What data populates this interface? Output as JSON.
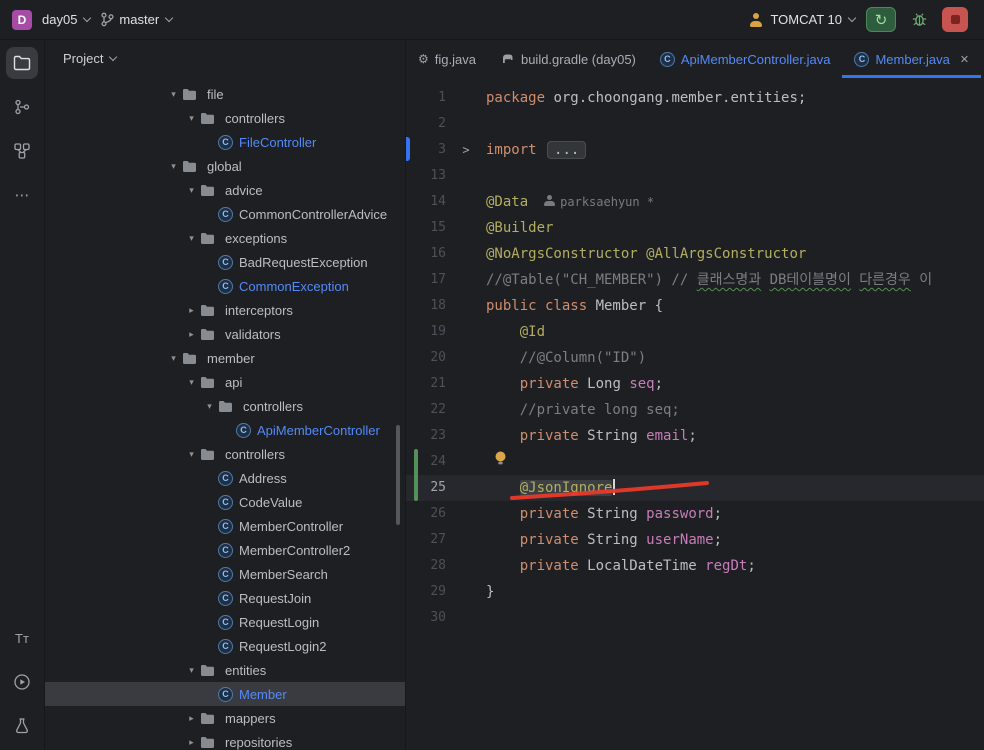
{
  "titlebar": {
    "project_badge": "D",
    "project_name": "day05",
    "branch": "master",
    "run_config": "TOMCAT 10"
  },
  "panel": {
    "header": "Project"
  },
  "icons": {
    "more_glyph": "⋯",
    "text_tool_glyph": "Тт",
    "close_glyph": "✕",
    "chevron_expanded": "▾",
    "chevron_collapsed": "▸",
    "fold_glyph": ">",
    "class_badge": "C",
    "run_glyph": "↻"
  },
  "tabs": [
    {
      "label": "fig.java",
      "icon": "gear",
      "state": "plain"
    },
    {
      "label": "build.gradle (day05)",
      "icon": "gradle",
      "state": "plain"
    },
    {
      "label": "ApiMemberController.java",
      "icon": "class",
      "state": "modified"
    },
    {
      "label": "Member.java",
      "icon": "class",
      "state": "modified",
      "active": true,
      "closable": true
    }
  ],
  "tree": [
    {
      "label": "file",
      "kind": "folder",
      "level": 0,
      "expanded": true
    },
    {
      "label": "controllers",
      "kind": "folder",
      "level": 1,
      "expanded": true
    },
    {
      "label": "FileController",
      "kind": "class",
      "level": 2,
      "modified": true
    },
    {
      "label": "global",
      "kind": "folder",
      "level": 0,
      "expanded": true
    },
    {
      "label": "advice",
      "kind": "folder",
      "level": 1,
      "expanded": true
    },
    {
      "label": "CommonControllerAdvice",
      "kind": "class",
      "level": 2
    },
    {
      "label": "exceptions",
      "kind": "folder",
      "level": 1,
      "expanded": true
    },
    {
      "label": "BadRequestException",
      "kind": "class",
      "level": 2
    },
    {
      "label": "CommonException",
      "kind": "class",
      "level": 2,
      "modified": true
    },
    {
      "label": "interceptors",
      "kind": "folder",
      "level": 1,
      "expanded": false
    },
    {
      "label": "validators",
      "kind": "folder",
      "level": 1,
      "expanded": false
    },
    {
      "label": "member",
      "kind": "folder",
      "level": 0,
      "expanded": true
    },
    {
      "label": "api",
      "kind": "folder",
      "level": 1,
      "expanded": true
    },
    {
      "label": "controllers",
      "kind": "folder",
      "level": 2,
      "expanded": true
    },
    {
      "label": "ApiMemberController",
      "kind": "class",
      "level": 3,
      "modified": true
    },
    {
      "label": "controllers",
      "kind": "folder",
      "level": 1,
      "expanded": true
    },
    {
      "label": "Address",
      "kind": "class",
      "level": 2
    },
    {
      "label": "CodeValue",
      "kind": "class",
      "level": 2
    },
    {
      "label": "MemberController",
      "kind": "class",
      "level": 2
    },
    {
      "label": "MemberController2",
      "kind": "class",
      "level": 2
    },
    {
      "label": "MemberSearch",
      "kind": "class",
      "level": 2
    },
    {
      "label": "RequestJoin",
      "kind": "class",
      "level": 2
    },
    {
      "label": "RequestLogin",
      "kind": "class",
      "level": 2
    },
    {
      "label": "RequestLogin2",
      "kind": "class",
      "level": 2
    },
    {
      "label": "entities",
      "kind": "folder",
      "level": 1,
      "expanded": true
    },
    {
      "label": "Member",
      "kind": "class",
      "level": 2,
      "modified": true,
      "selected": true
    },
    {
      "label": "mappers",
      "kind": "folder",
      "level": 1,
      "expanded": false
    },
    {
      "label": "repositories",
      "kind": "folder",
      "level": 1,
      "expanded": false
    }
  ],
  "editor": {
    "lines": [
      {
        "num": "1",
        "segs": [
          [
            "kw",
            "package "
          ],
          [
            "pl",
            "org.choongang.member.entities;"
          ]
        ]
      },
      {
        "num": "2",
        "segs": []
      },
      {
        "num": "3",
        "fold": true,
        "segs": [
          [
            "kw",
            "import "
          ],
          [
            "fold",
            "..."
          ]
        ]
      },
      {
        "num": "13",
        "segs": []
      },
      {
        "num": "14",
        "segs": [
          [
            "ann",
            "@Data"
          ],
          [
            "inlay",
            "parksaehyun *"
          ]
        ]
      },
      {
        "num": "15",
        "segs": [
          [
            "ann",
            "@Builder"
          ]
        ]
      },
      {
        "num": "16",
        "segs": [
          [
            "ann",
            "@NoArgsConstructor"
          ],
          [
            "pl",
            " "
          ],
          [
            "ann",
            "@AllArgsConstructor"
          ]
        ]
      },
      {
        "num": "17",
        "segs": [
          [
            "cm",
            "//@Table(\"CH_MEMBER\") // "
          ],
          [
            "typo",
            "클래스명과"
          ],
          [
            "cm",
            " "
          ],
          [
            "typo",
            "DB테이블명이"
          ],
          [
            "cm",
            " "
          ],
          [
            "typo",
            "다른경우"
          ],
          [
            "cm",
            " 이"
          ]
        ]
      },
      {
        "num": "18",
        "segs": [
          [
            "kw",
            "public class "
          ],
          [
            "pl",
            "Member {"
          ]
        ]
      },
      {
        "num": "19",
        "segs": [
          [
            "pl",
            "    "
          ],
          [
            "ann",
            "@Id"
          ]
        ]
      },
      {
        "num": "20",
        "segs": [
          [
            "pl",
            "    "
          ],
          [
            "cm",
            "//@Column(\"ID\")"
          ]
        ]
      },
      {
        "num": "21",
        "segs": [
          [
            "pl",
            "    "
          ],
          [
            "kw",
            "private "
          ],
          [
            "pl",
            "Long "
          ],
          [
            "fd",
            "seq"
          ],
          [
            "pl",
            ";"
          ]
        ]
      },
      {
        "num": "22",
        "segs": [
          [
            "pl",
            "    "
          ],
          [
            "cm",
            "//private long seq;"
          ]
        ]
      },
      {
        "num": "23",
        "segs": [
          [
            "pl",
            "    "
          ],
          [
            "kw",
            "private "
          ],
          [
            "pl",
            "String "
          ],
          [
            "fd",
            "email"
          ],
          [
            "pl",
            ";"
          ]
        ]
      },
      {
        "num": "24",
        "bulb": true,
        "segs": []
      },
      {
        "num": "25",
        "current": true,
        "caret": true,
        "segs": [
          [
            "pl",
            "    "
          ],
          [
            "annhl",
            "@JsonIgnore"
          ]
        ]
      },
      {
        "num": "26",
        "segs": [
          [
            "pl",
            "    "
          ],
          [
            "kw",
            "private "
          ],
          [
            "pl",
            "String "
          ],
          [
            "fd",
            "password"
          ],
          [
            "pl",
            ";"
          ]
        ]
      },
      {
        "num": "27",
        "segs": [
          [
            "pl",
            "    "
          ],
          [
            "kw",
            "private "
          ],
          [
            "pl",
            "String "
          ],
          [
            "fd",
            "userName"
          ],
          [
            "pl",
            ";"
          ]
        ]
      },
      {
        "num": "28",
        "segs": [
          [
            "pl",
            "    "
          ],
          [
            "kw",
            "private "
          ],
          [
            "pl",
            "LocalDateTime "
          ],
          [
            "fd",
            "regDt"
          ],
          [
            "pl",
            ";"
          ]
        ]
      },
      {
        "num": "29",
        "segs": [
          [
            "pl",
            "}"
          ]
        ]
      },
      {
        "num": "30",
        "segs": []
      }
    ]
  },
  "colors": {
    "accent": "#3574F0",
    "modified_file": "#548AF7",
    "keyword": "#CF8E6D",
    "annotation": "#B3AE60",
    "comment": "#7A7E85",
    "field": "#C77DBB",
    "selection_bg": "#393B40",
    "current_line_bg": "#26282E",
    "red_marker": "#E8392B"
  }
}
